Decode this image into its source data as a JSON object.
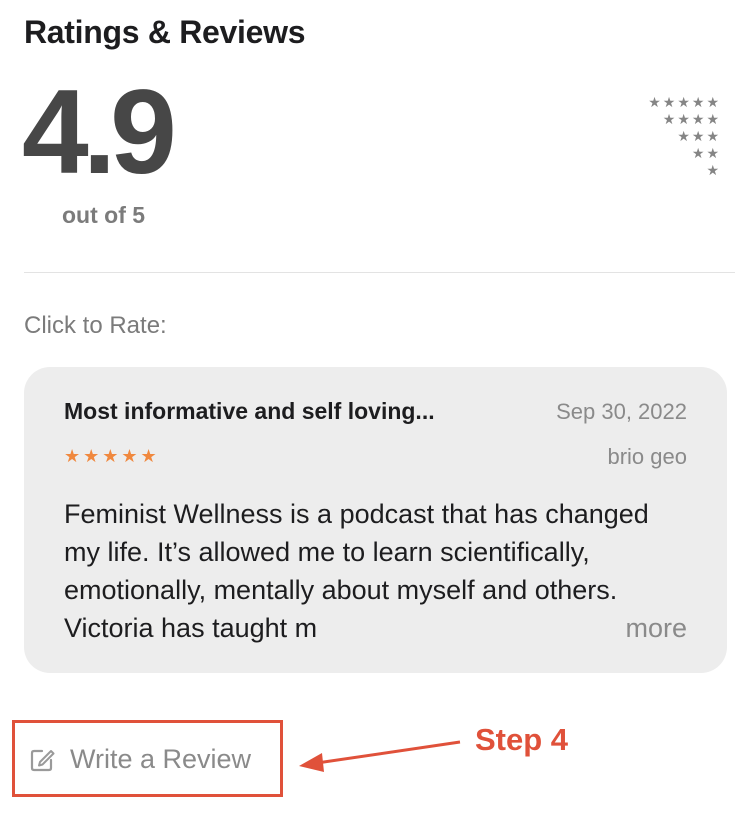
{
  "section": {
    "title": "Ratings & Reviews"
  },
  "summary": {
    "rating": "4.9",
    "scale": "out of 5",
    "histogram_rows": [
      "★★★★★",
      "★★★★",
      "★★★",
      "★★",
      "★"
    ]
  },
  "rate": {
    "label": "Click to Rate:"
  },
  "review": {
    "title": "Most informative and self loving...",
    "date": "Sep 30, 2022",
    "stars": "★★★★★",
    "star_count": 5,
    "author": "brio geo",
    "body": "Feminist Wellness is a podcast that has changed my life. It’s allowed me to learn scientifically, emotionally, mentally about myself and others. Victoria has taught m",
    "more_label": "more"
  },
  "actions": {
    "write_review_label": "Write a Review"
  },
  "annotation": {
    "step_label": "Step 4",
    "color": "#e0513a"
  },
  "colors": {
    "accent_star": "#f0883e",
    "card_bg": "#ededed"
  },
  "icons": {
    "write_review": "compose-icon"
  }
}
